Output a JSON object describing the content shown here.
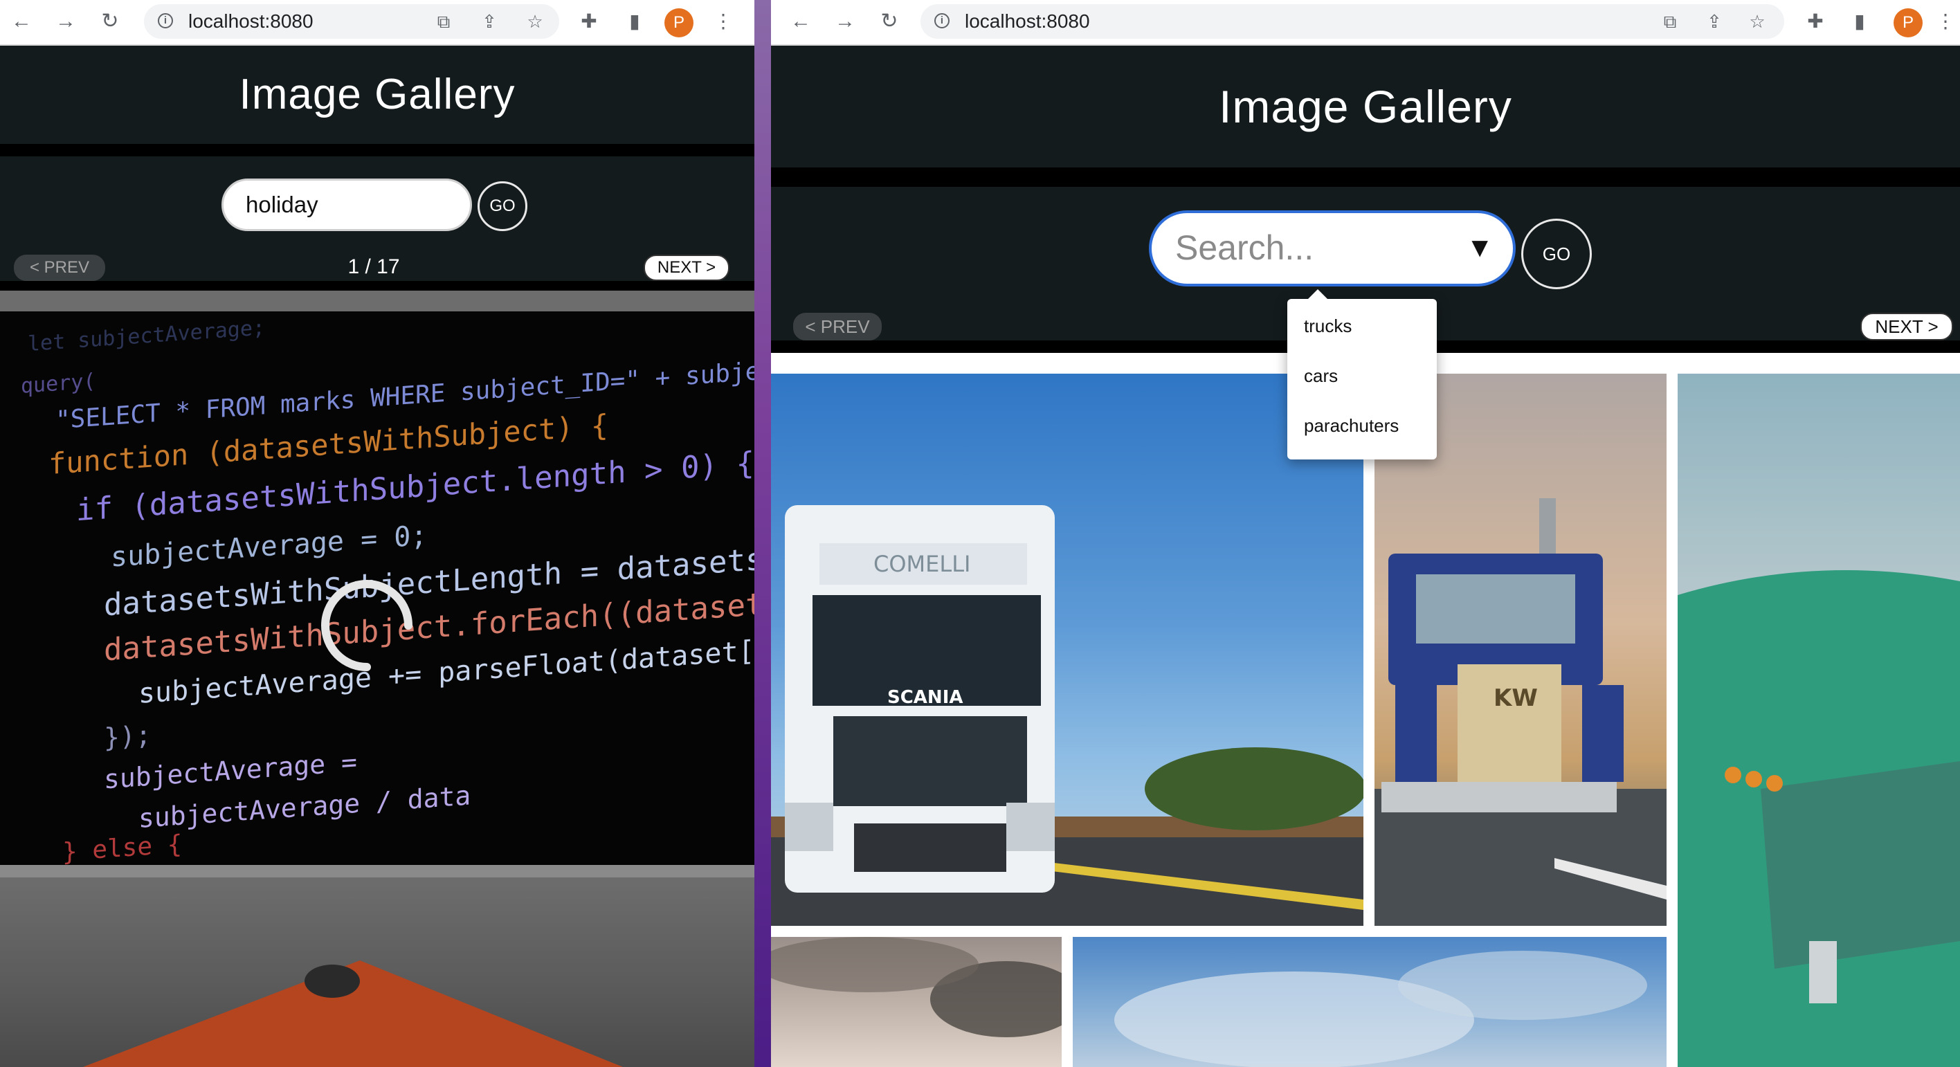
{
  "left_browser": {
    "url": "localhost:8080",
    "avatar_letter": "P",
    "page": {
      "title": "Image Gallery",
      "search_value": "holiday",
      "go_label": "GO",
      "prev_label": "< PREV",
      "next_label": "NEXT >",
      "pagination": "1 / 17",
      "loading": true
    }
  },
  "right_browser": {
    "url": "localhost:8080",
    "avatar_letter": "P",
    "page": {
      "title": "Image Gallery",
      "search_placeholder": "Search...",
      "go_label": "GO",
      "prev_label": "< PREV",
      "next_label": "NEXT >",
      "suggestions": [
        "trucks",
        "cars",
        "parachuters"
      ],
      "truck_brand_1": "COMELLI",
      "truck_badge_1": "SCANIA",
      "truck_badge_2": "KW"
    }
  },
  "colors": {
    "page_bg": "#141b1d",
    "focus_ring": "#2f6ed8",
    "avatar": "#e46f1e"
  }
}
